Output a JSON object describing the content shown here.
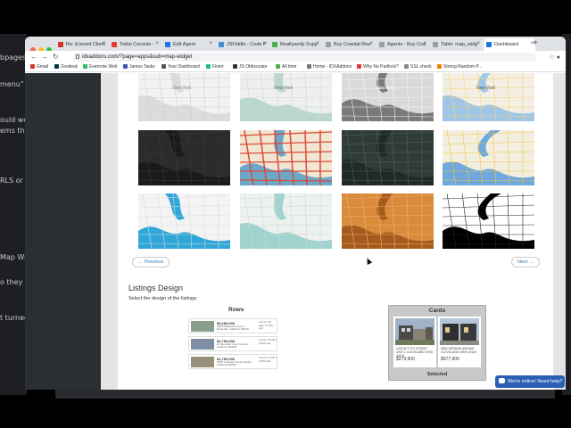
{
  "background_editor": {
    "lines": [
      "bpages",
      "menu\" it",
      "ould wo",
      "ems tha",
      "RLS or th",
      "Map Wid",
      "o they ca",
      "t turned"
    ]
  },
  "browser": {
    "tabs": [
      {
        "label": "Re: Errored Client",
        "color": "#d93025"
      },
      {
        "label": "Twilio Console -",
        "color": "#e53935"
      },
      {
        "label": "Edit Agent",
        "color": "#1a73e8"
      },
      {
        "label": "JSFiddle - Code P",
        "color": "#3f8fd2"
      },
      {
        "label": "Realtyandy Supp",
        "color": "#4caf50"
      },
      {
        "label": "Buy Coastal Rea",
        "color": "#9e9e9e"
      },
      {
        "label": "Agents - Buy Coa",
        "color": "#9e9e9e"
      },
      {
        "label": "Table: map_widg",
        "color": "#9e9e9e"
      },
      {
        "label": "Dashboard",
        "color": "#1a73e8"
      }
    ],
    "url": "idxaddons.com/?page=apps&sub=map-widget",
    "bookmarks": [
      {
        "label": "Gmail",
        "color": "#d93025"
      },
      {
        "label": "Zendesk",
        "color": "#03363d"
      },
      {
        "label": "Evernote Web",
        "color": "#2dbe60"
      },
      {
        "label": "James Tasks",
        "color": "#3f51b5"
      },
      {
        "label": "Your Dashboard",
        "color": "#555555"
      },
      {
        "label": "Fiverr",
        "color": "#1dbf73"
      },
      {
        "label": "JS Obfuscator",
        "color": "#333333"
      },
      {
        "label": "All time",
        "color": "#4caf50"
      },
      {
        "label": "Home - IDXAddons",
        "color": "#777777"
      },
      {
        "label": "Why No Padlock?",
        "color": "#e53935"
      },
      {
        "label": "SSL check",
        "color": "#888888"
      },
      {
        "label": "Strong Random P...",
        "color": "#f57c00"
      }
    ]
  },
  "page": {
    "map_tiles": [
      {
        "style": "light-gray",
        "label": "New York"
      },
      {
        "style": "gray-teal",
        "label": "New York"
      },
      {
        "style": "mono",
        "label": "New York"
      },
      {
        "style": "color",
        "label": "New York"
      },
      {
        "style": "dark",
        "label": ""
      },
      {
        "style": "red-roads",
        "label": ""
      },
      {
        "style": "dark-green",
        "label": ""
      },
      {
        "style": "bright",
        "label": ""
      },
      {
        "style": "blue-water",
        "label": ""
      },
      {
        "style": "teal-light",
        "label": ""
      },
      {
        "style": "orange",
        "label": ""
      },
      {
        "style": "black-white",
        "label": ""
      }
    ],
    "previous_label": "← Previous",
    "next_label": "Next →",
    "listings_heading": "Listings Design",
    "listings_sub": "Select the design of the listings:",
    "rows_title": "Rows",
    "rows": [
      {
        "price": "$3,250,000",
        "address": "4000 Ridgewood Court Roseville, California 95678",
        "meta": "4 bed | 4.5 bath | 5,400 sqft"
      },
      {
        "price": "$1,799,000",
        "address": "10 Glenvale Court Granite, California 95678",
        "meta": "4 bed | 3 bath | 3,900 sqft"
      },
      {
        "price": "$1,750,000",
        "address": "1080 Yosemite Circle Granite, California 95678",
        "meta": "3 bed | 2 bath | 3,204 sqft"
      }
    ],
    "cards_title": "Cards",
    "cards": [
      {
        "address": "1432 W 77TH STREET UNIT 1 CLEVELAND OHIO 44113",
        "price": "$279,900"
      },
      {
        "address": "3805 HERMAN AVENUE CLEVELAND OHIO 44102",
        "price": "$577,900"
      }
    ],
    "cards_selected": "Selected",
    "chat_label": "We're online! Need help?"
  }
}
